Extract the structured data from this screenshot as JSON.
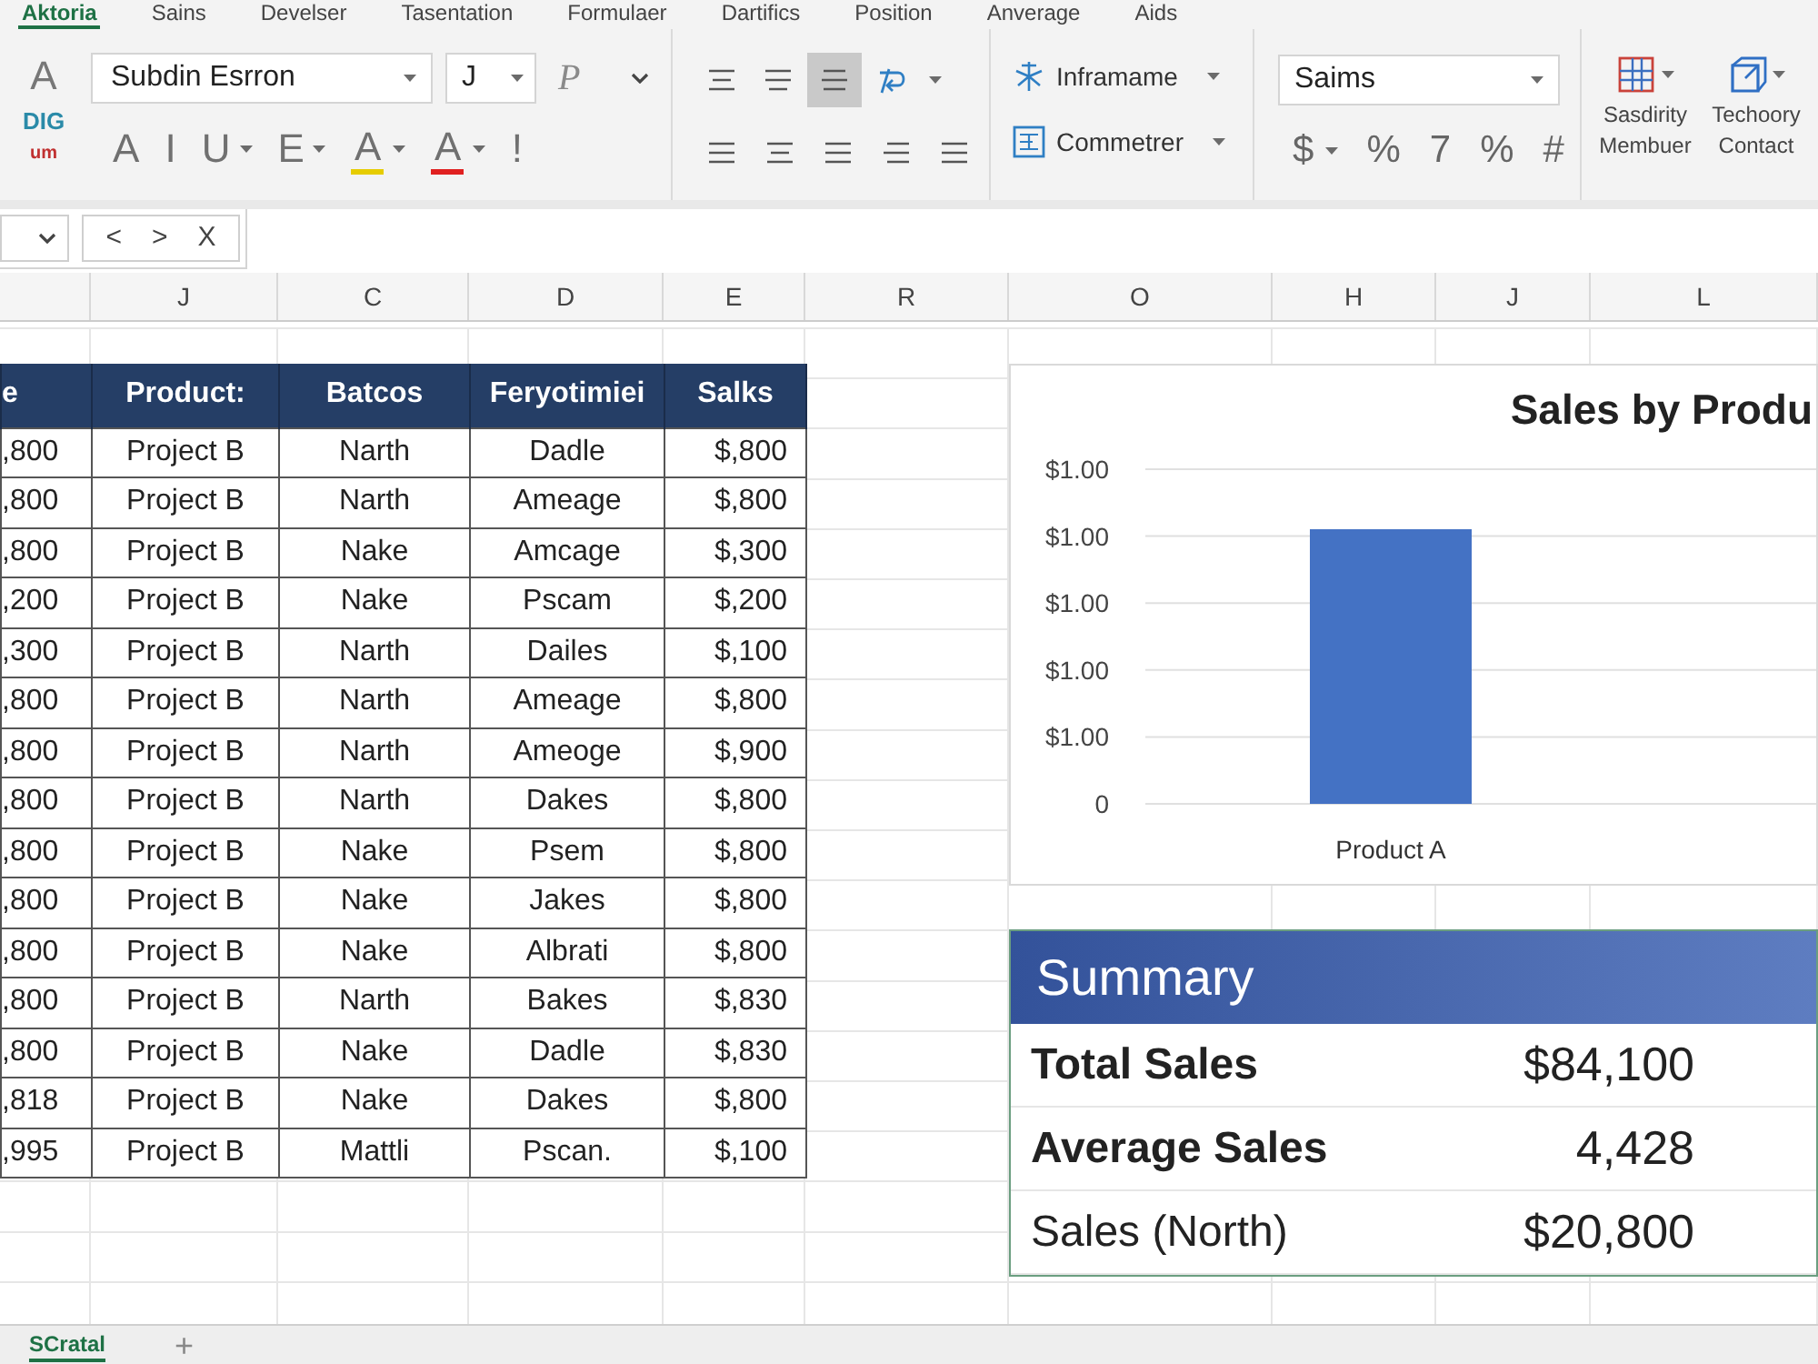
{
  "ribbon_tabs": [
    {
      "label": "Aktoria",
      "selected": true
    },
    {
      "label": "Sains",
      "selected": false
    },
    {
      "label": "Develser",
      "selected": false
    },
    {
      "label": "Tasentation",
      "selected": false
    },
    {
      "label": "Formulaer",
      "selected": false
    },
    {
      "label": "Dartifics",
      "selected": false
    },
    {
      "label": "Position",
      "selected": false
    },
    {
      "label": "Anverage",
      "selected": false
    },
    {
      "label": "Aids",
      "selected": false
    }
  ],
  "clipboard": [
    {
      "label": "A",
      "color": "#777777"
    },
    {
      "label": "DIG",
      "color": "#2a8aa8"
    },
    {
      "label": "um",
      "color": "#c03030"
    }
  ],
  "font": {
    "name": "Subdin Esrron",
    "size": "J",
    "style_button": "P",
    "buttons": [
      {
        "label": "A",
        "dropdown": false
      },
      {
        "label": "I",
        "dropdown": false
      },
      {
        "label": "U",
        "dropdown": true
      },
      {
        "label": "E",
        "dropdown": true
      },
      {
        "label": "A",
        "dropdown": true,
        "color": "#e6cc00"
      },
      {
        "label": "A",
        "dropdown": true,
        "color": "#e02020"
      },
      {
        "label": "!",
        "dropdown": false
      }
    ]
  },
  "alignment": {
    "buttons": [
      {
        "selected": false
      },
      {
        "selected": false
      },
      {
        "selected": true
      }
    ]
  },
  "styles": [
    {
      "label": "Inframame"
    },
    {
      "label": "Commetrer"
    }
  ],
  "number": {
    "format": "Saims",
    "buttons": [
      {
        "label": "$",
        "dropdown": true
      },
      {
        "label": "%",
        "dropdown": false
      },
      {
        "label": "7",
        "dropdown": false
      },
      {
        "label": "%",
        "dropdown": false
      },
      {
        "label": "#",
        "dropdown": false
      }
    ]
  },
  "commands": [
    {
      "label_lines": [
        "Sasdirity",
        "Membuer"
      ]
    },
    {
      "label_lines": [
        "Techoory",
        "Contact"
      ]
    }
  ],
  "formula_bar": {
    "buttons": [
      "<",
      ">",
      "X"
    ]
  },
  "column_headers": [
    "J",
    "C",
    "D",
    "E",
    "R",
    "O",
    "H",
    "J",
    "L"
  ],
  "table": {
    "columns": [
      "e",
      "Product:",
      "Batcos",
      "Feryotimiei",
      "Salks"
    ],
    "rows": [
      [
        ",800",
        "Project B",
        "Narth",
        "Dadle",
        "$,800"
      ],
      [
        ",800",
        "Project B",
        "Narth",
        "Ameage",
        "$,800"
      ],
      [
        ",800",
        "Project B",
        "Nake",
        "Amcage",
        "$,300"
      ],
      [
        ",200",
        "Project B",
        "Nake",
        "Pscam",
        "$,200"
      ],
      [
        ",300",
        "Project B",
        "Narth",
        "Dailes",
        "$,100"
      ],
      [
        ",800",
        "Project B",
        "Narth",
        "Ameage",
        "$,800"
      ],
      [
        ",800",
        "Project B",
        "Narth",
        "Ameoge",
        "$,900"
      ],
      [
        ",800",
        "Project B",
        "Narth",
        "Dakes",
        "$,800"
      ],
      [
        ",800",
        "Project B",
        "Nake",
        "Psem",
        "$,800"
      ],
      [
        ",800",
        "Project B",
        "Nake",
        "Jakes",
        "$,800"
      ],
      [
        ",800",
        "Project B",
        "Nake",
        "Albrati",
        "$,800"
      ],
      [
        ",800",
        "Project B",
        "Narth",
        "Bakes",
        "$,830"
      ],
      [
        ",800",
        "Project B",
        "Nake",
        "Dadle",
        "$,830"
      ],
      [
        ",818",
        "Project B",
        "Nake",
        "Dakes",
        "$,800"
      ],
      [
        ",995",
        "Project B",
        "Mattli",
        "Pscan.",
        "$,100"
      ]
    ]
  },
  "chart": {
    "title": "Sales by Produ",
    "axis_labels": [
      "$1.00",
      "$1.00",
      "$1.00",
      "$1.00",
      "$1.00",
      "0"
    ],
    "category_labels": [
      "Product A"
    ]
  },
  "summary": {
    "title": "Summary",
    "rows": [
      {
        "label": "Total Sales",
        "value": "$84,100",
        "bold": true
      },
      {
        "label": "Average Sales",
        "value": "4,428",
        "bold": true
      },
      {
        "label": "Sales (North)",
        "value": "$20,800",
        "bold": false
      }
    ]
  },
  "sheet_tabs": [
    {
      "label": "SCratal",
      "selected": true
    }
  ],
  "add_sheet": "+"
}
